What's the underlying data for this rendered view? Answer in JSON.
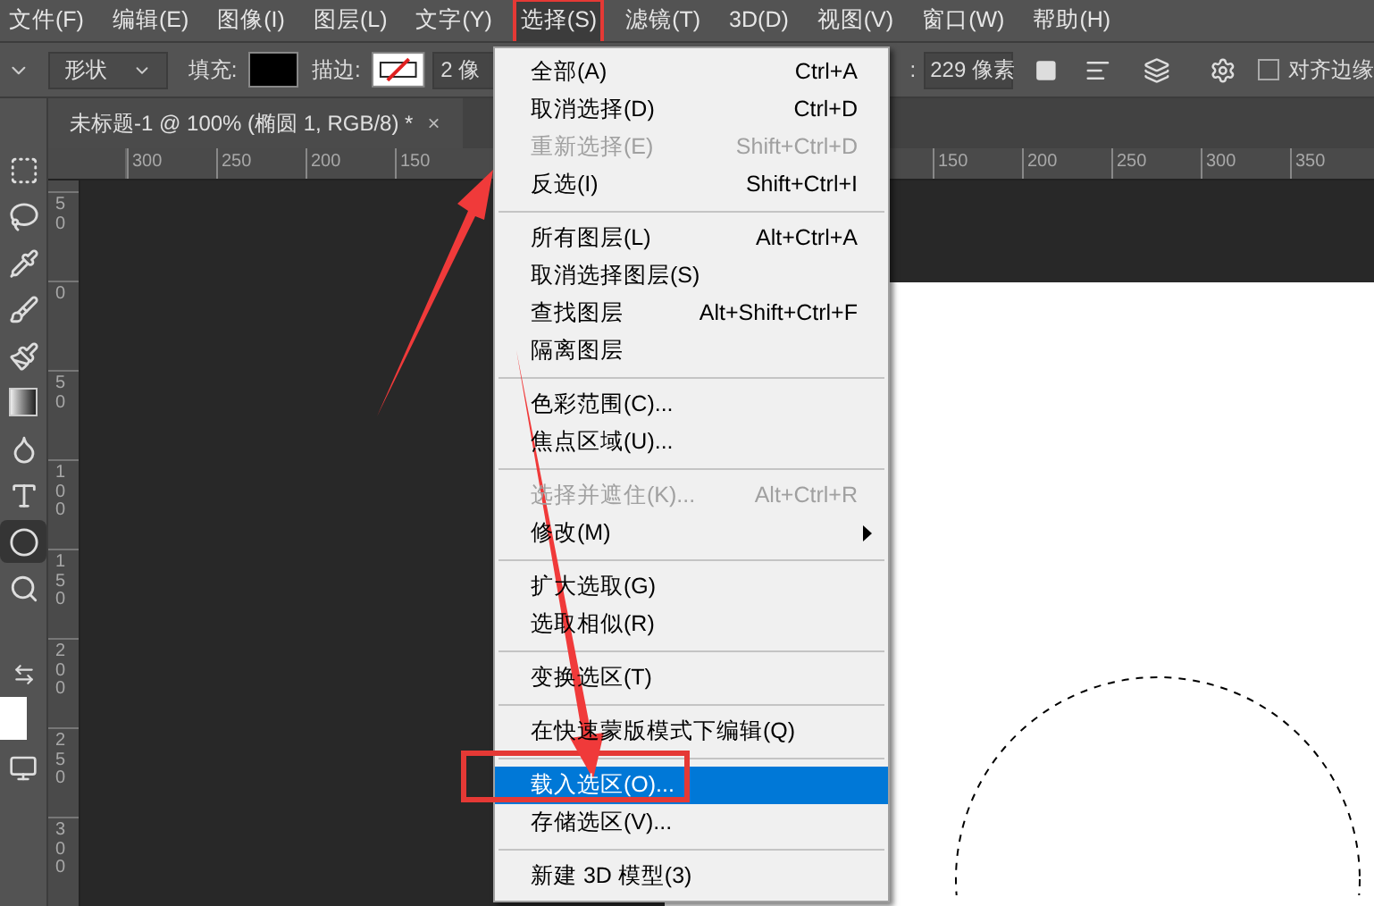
{
  "menu_bar": [
    {
      "label": "文件(F)",
      "selected": false
    },
    {
      "label": "编辑(E)",
      "selected": false
    },
    {
      "label": "图像(I)",
      "selected": false
    },
    {
      "label": "图层(L)",
      "selected": false
    },
    {
      "label": "文字(Y)",
      "selected": false
    },
    {
      "label": "选择(S)",
      "selected": true
    },
    {
      "label": "滤镜(T)",
      "selected": false
    },
    {
      "label": "3D(D)",
      "selected": false
    },
    {
      "label": "视图(V)",
      "selected": false
    },
    {
      "label": "窗口(W)",
      "selected": false
    },
    {
      "label": "帮助(H)",
      "selected": false
    }
  ],
  "options_bar": {
    "mode": "形状",
    "fill_label": "填充:",
    "stroke_label": "描边:",
    "stroke_width": "2 像",
    "height_label": ":",
    "height": "229 像素",
    "align_edges": {
      "label": "对齐边缘",
      "checked": false
    }
  },
  "tools": [
    {
      "kind": "marquee",
      "selected": false
    },
    {
      "kind": "lasso",
      "selected": false
    },
    {
      "kind": "eyedropper",
      "selected": false
    },
    {
      "kind": "brush",
      "selected": false
    },
    {
      "kind": "history-brush",
      "selected": false
    },
    {
      "kind": "gradient",
      "selected": false
    },
    {
      "kind": "smudge",
      "selected": false
    },
    {
      "kind": "type",
      "selected": false
    },
    {
      "kind": "ellipse",
      "selected": true
    },
    {
      "kind": "zoom",
      "selected": false
    }
  ],
  "document_tab": {
    "title": "未标题-1 @ 100% (椭圆 1, RGB/8) *",
    "close": "×"
  },
  "top_ruler": {
    "left_labels": [
      "300",
      "250",
      "200",
      "150"
    ],
    "right_labels": [
      "150",
      "200",
      "250",
      "300",
      "350"
    ]
  },
  "left_ruler": [
    "50",
    "0",
    "50",
    "100",
    "150",
    "200",
    "250",
    "300"
  ],
  "menu": [
    {
      "kind": "item",
      "label": "全部(A)",
      "shortcut": "Ctrl+A",
      "disabled": false,
      "selected": false
    },
    {
      "kind": "item",
      "label": "取消选择(D)",
      "shortcut": "Ctrl+D",
      "disabled": false,
      "selected": false
    },
    {
      "kind": "item",
      "label": "重新选择(E)",
      "shortcut": "Shift+Ctrl+D",
      "disabled": true,
      "selected": false
    },
    {
      "kind": "item",
      "label": "反选(I)",
      "shortcut": "Shift+Ctrl+I",
      "disabled": false,
      "selected": false
    },
    {
      "kind": "separator"
    },
    {
      "kind": "item",
      "label": "所有图层(L)",
      "shortcut": "Alt+Ctrl+A",
      "disabled": false,
      "selected": false
    },
    {
      "kind": "item",
      "label": "取消选择图层(S)",
      "disabled": false,
      "selected": false
    },
    {
      "kind": "item",
      "label": "查找图层",
      "shortcut": "Alt+Shift+Ctrl+F",
      "disabled": false,
      "selected": false
    },
    {
      "kind": "item",
      "label": "隔离图层",
      "disabled": false,
      "selected": false
    },
    {
      "kind": "separator"
    },
    {
      "kind": "item",
      "label": "色彩范围(C)...",
      "disabled": false,
      "selected": false
    },
    {
      "kind": "item",
      "label": "焦点区域(U)...",
      "disabled": false,
      "selected": false
    },
    {
      "kind": "separator"
    },
    {
      "kind": "item",
      "label": "选择并遮住(K)...",
      "shortcut": "Alt+Ctrl+R",
      "disabled": true,
      "selected": false
    },
    {
      "kind": "submenu",
      "label": "修改(M)",
      "disabled": false,
      "selected": false
    },
    {
      "kind": "separator"
    },
    {
      "kind": "item",
      "label": "扩大选取(G)",
      "disabled": false,
      "selected": false
    },
    {
      "kind": "item",
      "label": "选取相似(R)",
      "disabled": false,
      "selected": false
    },
    {
      "kind": "separator"
    },
    {
      "kind": "item",
      "label": "变换选区(T)",
      "disabled": false,
      "selected": false
    },
    {
      "kind": "separator"
    },
    {
      "kind": "item",
      "label": "在快速蒙版模式下编辑(Q)",
      "disabled": false,
      "selected": false
    },
    {
      "kind": "separator"
    },
    {
      "kind": "item",
      "label": "载入选区(O)...",
      "disabled": false,
      "selected": true
    },
    {
      "kind": "item",
      "label": "存储选区(V)...",
      "disabled": false,
      "selected": false
    },
    {
      "kind": "separator"
    },
    {
      "kind": "item",
      "label": "新建 3D 模型(3)",
      "disabled": false,
      "selected": false
    }
  ]
}
